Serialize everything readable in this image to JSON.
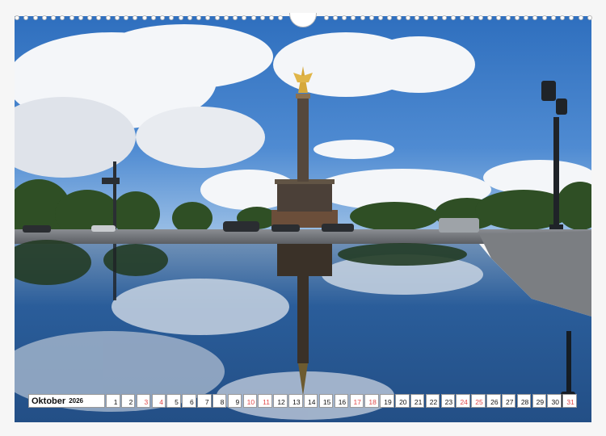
{
  "calendar": {
    "month": "Oktober",
    "year": "2026",
    "days": [
      {
        "n": "1",
        "weekend": false
      },
      {
        "n": "2",
        "weekend": false
      },
      {
        "n": "3",
        "weekend": true
      },
      {
        "n": "4",
        "weekend": true
      },
      {
        "n": "5",
        "weekend": false
      },
      {
        "n": "6",
        "weekend": false
      },
      {
        "n": "7",
        "weekend": false
      },
      {
        "n": "8",
        "weekend": false
      },
      {
        "n": "9",
        "weekend": false
      },
      {
        "n": "10",
        "weekend": true
      },
      {
        "n": "11",
        "weekend": true
      },
      {
        "n": "12",
        "weekend": false
      },
      {
        "n": "13",
        "weekend": false
      },
      {
        "n": "14",
        "weekend": false
      },
      {
        "n": "15",
        "weekend": false
      },
      {
        "n": "16",
        "weekend": false
      },
      {
        "n": "17",
        "weekend": true
      },
      {
        "n": "18",
        "weekend": true
      },
      {
        "n": "19",
        "weekend": false
      },
      {
        "n": "20",
        "weekend": false
      },
      {
        "n": "21",
        "weekend": false
      },
      {
        "n": "22",
        "weekend": false
      },
      {
        "n": "23",
        "weekend": false
      },
      {
        "n": "24",
        "weekend": true
      },
      {
        "n": "25",
        "weekend": true
      },
      {
        "n": "26",
        "weekend": false
      },
      {
        "n": "27",
        "weekend": false
      },
      {
        "n": "28",
        "weekend": false
      },
      {
        "n": "29",
        "weekend": false
      },
      {
        "n": "30",
        "weekend": false
      },
      {
        "n": "31",
        "weekend": true
      }
    ]
  },
  "colors": {
    "sky": "#3a78c4",
    "accent_weekend": "#e04848"
  }
}
